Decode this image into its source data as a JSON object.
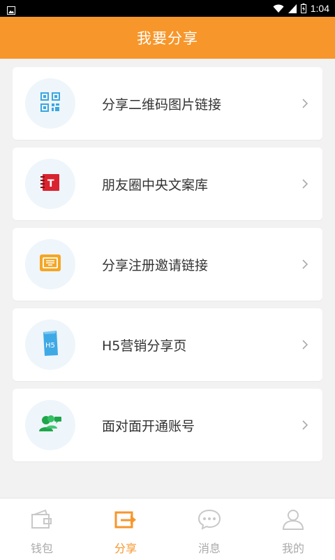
{
  "status_bar": {
    "time": "1:04"
  },
  "header": {
    "title": "我要分享"
  },
  "menu": {
    "items": [
      {
        "label": "分享二维码图片链接",
        "icon": "qrcode-icon"
      },
      {
        "label": "朋友圈中央文案库",
        "icon": "notebook-icon"
      },
      {
        "label": "分享注册邀请链接",
        "icon": "ticket-icon"
      },
      {
        "label": "H5营销分享页",
        "icon": "h5-page-icon"
      },
      {
        "label": "面对面开通账号",
        "icon": "users-icon"
      }
    ]
  },
  "tab_bar": {
    "active_tab": "分享",
    "active_color": "#f7962a",
    "tabs": [
      {
        "label": "钱包",
        "icon": "wallet-icon"
      },
      {
        "label": "分享",
        "icon": "share-icon"
      },
      {
        "label": "消息",
        "icon": "message-icon"
      },
      {
        "label": "我的",
        "icon": "profile-icon"
      }
    ]
  },
  "colors": {
    "header_bg": "#f7962a",
    "page_bg": "#f2f2f2",
    "icon_circle_bg": "#eef5fb"
  }
}
